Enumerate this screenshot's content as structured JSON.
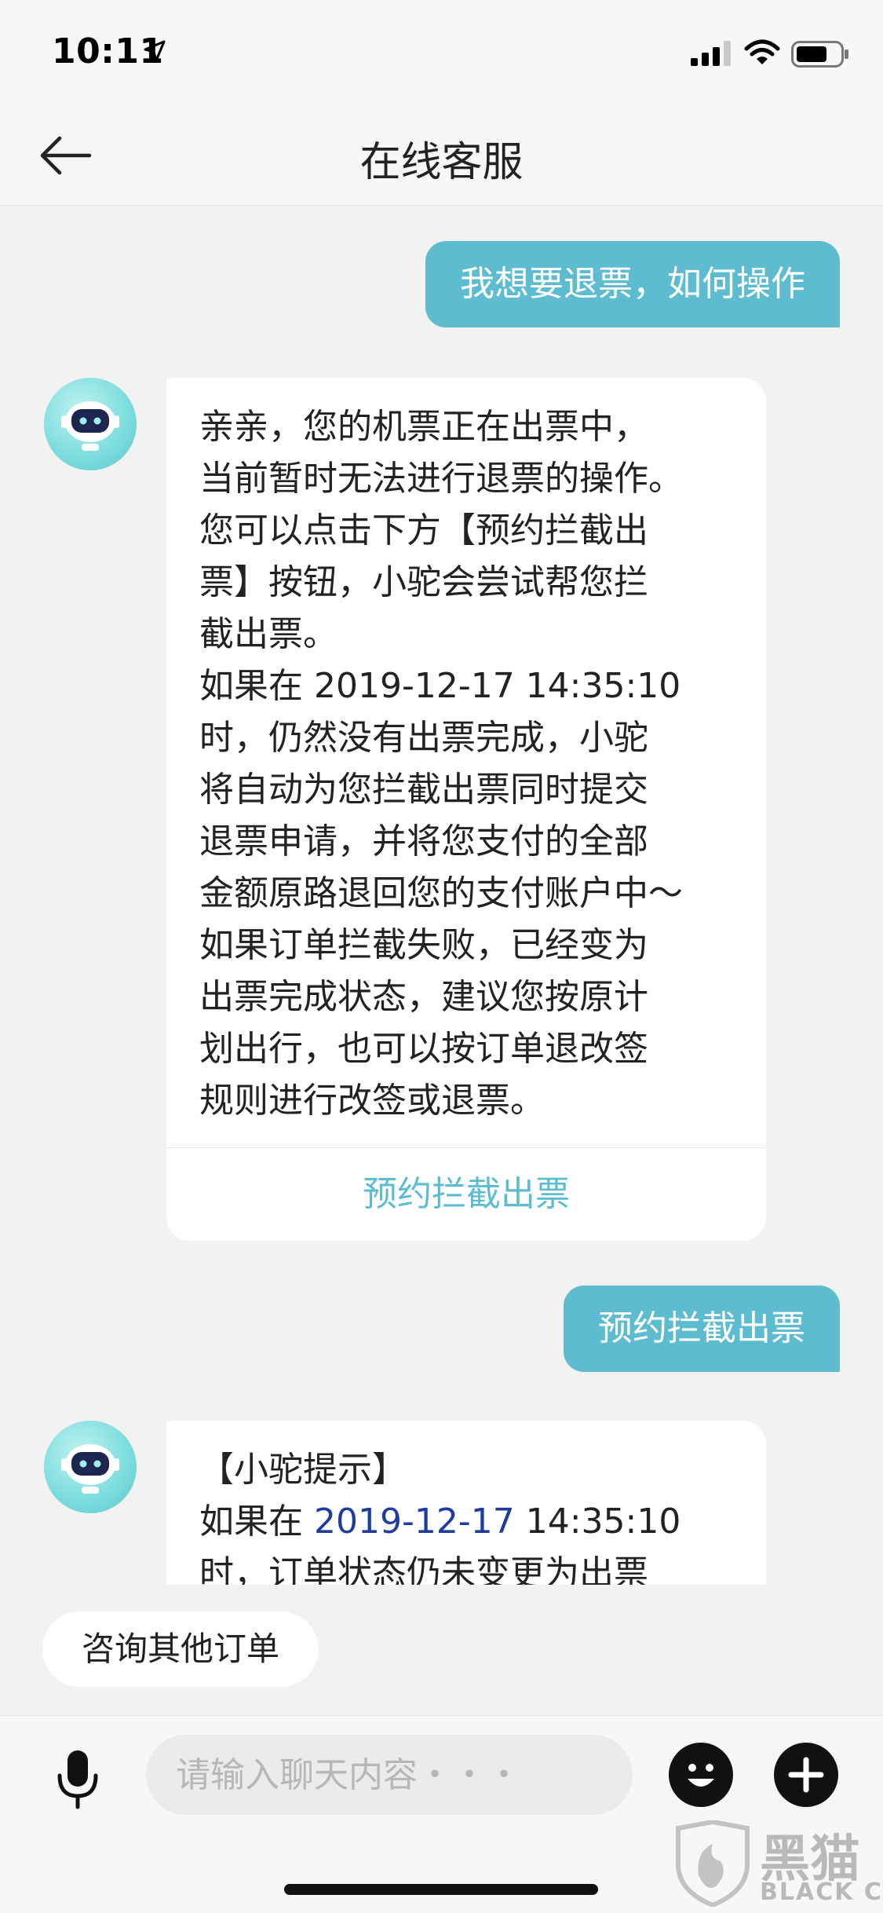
{
  "status_bar": {
    "time": "10:11",
    "location_icon": "location-arrow-icon",
    "signal_icon": "cellular-signal-icon",
    "wifi_icon": "wifi-icon",
    "battery_icon": "battery-icon"
  },
  "nav": {
    "title": "在线客服",
    "back_icon": "back-arrow-icon"
  },
  "messages": [
    {
      "from": "user",
      "text": "我想要退票，如何操作"
    },
    {
      "from": "bot",
      "lines": [
        "亲亲，您的机票正在出票中，",
        "当前暂时无法进行退票的操作。",
        "您可以点击下方【预约拦截出",
        "票】按钮，小驼会尝试帮您拦",
        "截出票。",
        "如果在 2019-12-17 14:35:10",
        "时，仍然没有出票完成，小驼",
        "将自动为您拦截出票同时提交",
        "退票申请，并将您支付的全部",
        "金额原路退回您的支付账户中～",
        "如果订单拦截失败，已经变为",
        "出票完成状态，建议您按原计",
        "划出行，也可以按订单退改签",
        "规则进行改签或退票。"
      ],
      "action_label": "预约拦截出票"
    },
    {
      "from": "user",
      "text": "预约拦截出票"
    },
    {
      "from": "bot",
      "line1": "【小驼提示】",
      "line2_prefix": "如果在 ",
      "line2_link": "2019-12-17",
      "line2_suffix": " 14:35:10",
      "line3": "时，订单状态仍未变更为出票"
    }
  ],
  "quick_reply": "咨询其他订单",
  "input": {
    "placeholder": "请输入聊天内容・・・",
    "value": ""
  },
  "watermark": {
    "title": "黑猫",
    "subtitle": "BLACK CAT"
  },
  "colors": {
    "accent": "#5dbccf",
    "link": "#1f3d9c",
    "background": "#f2f2f3"
  }
}
